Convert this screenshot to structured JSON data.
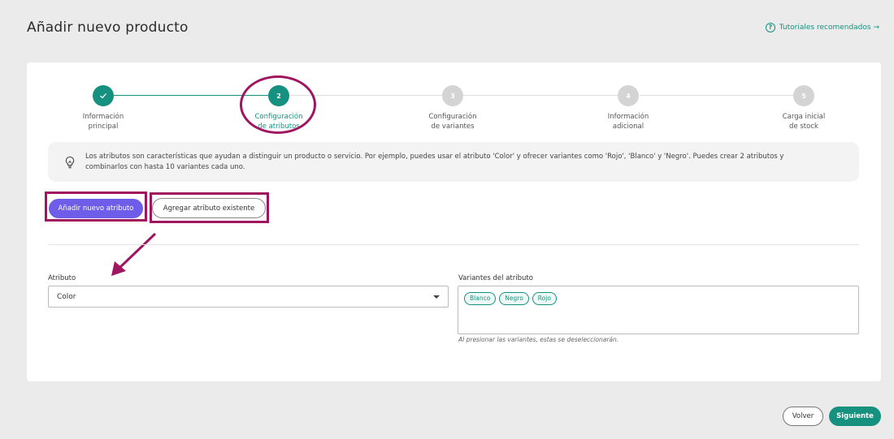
{
  "page": {
    "title": "Añadir nuevo producto",
    "tutorials_link": "Tutoriales recomendados →"
  },
  "stepper": {
    "steps": [
      {
        "number": "✓",
        "label_line1": "Información",
        "label_line2": "principal",
        "status": "completed"
      },
      {
        "number": "2",
        "label_line1": "Configuración",
        "label_line2": "de atributos",
        "status": "active"
      },
      {
        "number": "3",
        "label_line1": "Configuración",
        "label_line2": "de variantes",
        "status": "pending"
      },
      {
        "number": "4",
        "label_line1": "Información",
        "label_line2": "adicional",
        "status": "pending"
      },
      {
        "number": "5",
        "label_line1": "Carga inicial",
        "label_line2": "de stock",
        "status": "pending"
      }
    ]
  },
  "info": {
    "text": "Los atributos son características que ayudan a distinguir un producto o servicio. Por ejemplo, puedes usar el atributo 'Color' y ofrecer variantes como 'Rojo', 'Blanco' y 'Negro'. Puedes crear 2 atributos y combinarlos con hasta 10 variantes cada uno."
  },
  "actions": {
    "add_new_attribute": "Añadir nuevo atributo",
    "add_existing_attribute": "Agregar atributo existente"
  },
  "form": {
    "attribute_label": "Atributo",
    "attribute_value": "Color",
    "variants_label": "Variantes del atributo",
    "variants": [
      "Blanco",
      "Negro",
      "Rojo"
    ],
    "variants_hint": "Al presionar las variantes, estas se deseleccionarán."
  },
  "footer": {
    "back_label": "Volver",
    "next_label": "Siguiente"
  },
  "colors": {
    "accent": "#17917f",
    "primary_button": "#6e5de8",
    "annotation": "#a0155f",
    "pending_step": "#d4d4d4"
  }
}
